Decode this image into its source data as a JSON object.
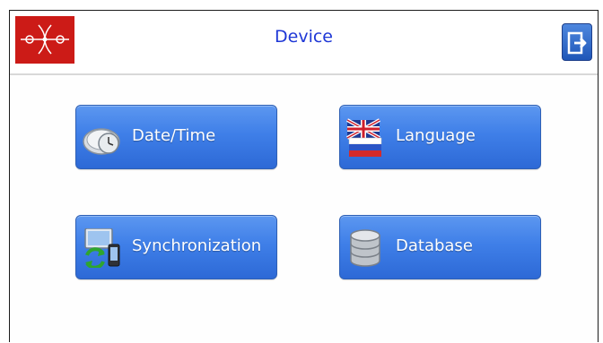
{
  "header": {
    "title": "Device",
    "logo_icon": "company-logo",
    "exit_icon": "exit-icon",
    "brand_color": "#cc1b17",
    "title_color": "#1e37d6"
  },
  "menu": {
    "datetime": {
      "label": "Date/Time",
      "icon": "clock-icon"
    },
    "language": {
      "label": "Language",
      "icon": "flags-icon"
    },
    "synchronization": {
      "label": "Synchronization",
      "icon": "sync-devices-icon"
    },
    "database": {
      "label": "Database",
      "icon": "database-icon"
    },
    "button_color": "#3f7fe8"
  }
}
